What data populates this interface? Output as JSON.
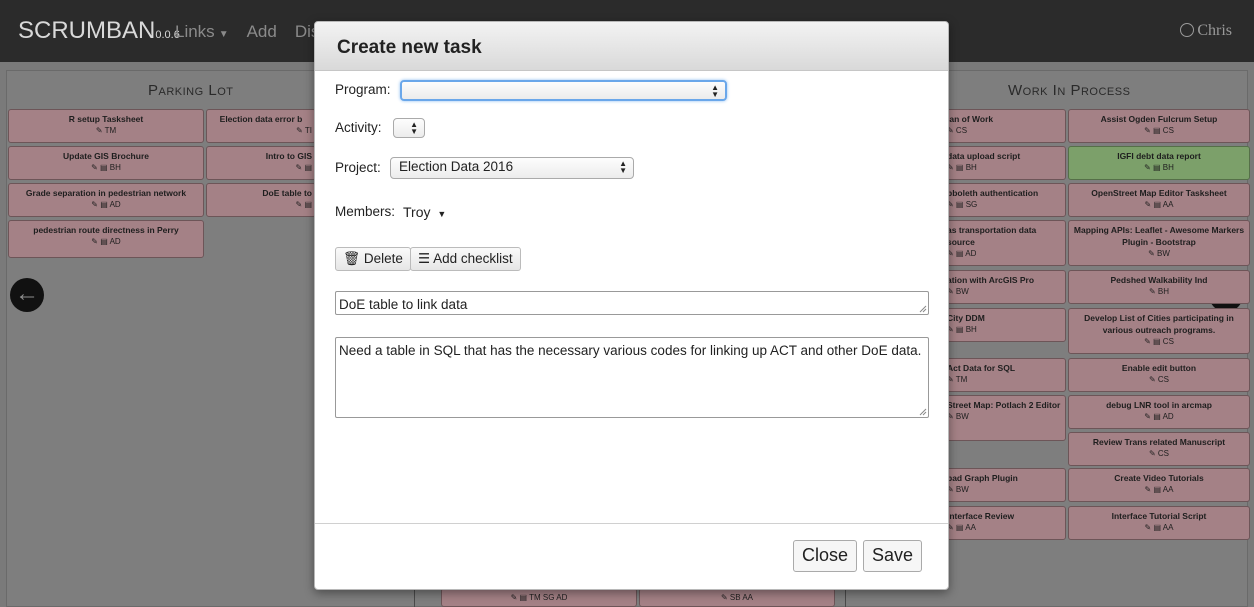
{
  "navbar": {
    "brand": "SCRUMBAN",
    "version": "0.0.6",
    "links": [
      {
        "label": "Links",
        "caret": true
      },
      {
        "label": "Add",
        "caret": false
      },
      {
        "label": "Dis",
        "caret": false
      }
    ],
    "user": "Chris"
  },
  "board": {
    "parking_lot": {
      "title": "Parking Lot",
      "cards": [
        {
          "title": "R setup Tasksheet",
          "meta": "✎ TM"
        },
        {
          "title": "Election data error b",
          "meta": "✎ TI"
        },
        {
          "title": "Update GIS Brochure",
          "meta": "✎ ▤ BH"
        },
        {
          "title": "Intro to GIS",
          "meta": "✎ ▤"
        },
        {
          "title": "Grade separation in pedestrian network",
          "meta": "✎ ▤ AD"
        },
        {
          "title": "DoE table to",
          "meta": "✎ ▤"
        },
        {
          "title": "pedestrian route directness in Perry",
          "meta": "✎ ▤ AD"
        }
      ]
    },
    "middle_bottom": [
      {
        "meta": "✎ ▤ TM SG AD"
      },
      {
        "meta": "✎ SB AA"
      }
    ],
    "work_in_process": {
      "title": "Work In Process",
      "left_cards": [
        {
          "title": "lan of Work",
          "meta": "✎ CS"
        },
        {
          "title": "data upload script",
          "meta": "✎ ▤ BH"
        },
        {
          "title": "bboleth authentication",
          "meta": "✎ ▤ SG"
        },
        {
          "title": "as transportation data source",
          "meta": "✎ ▤ AD"
        },
        {
          "title": "ation with ArcGIS Pro",
          "meta": "✎ BW"
        },
        {
          "title": "City DDM",
          "meta": "✎ ▤ BH"
        },
        {
          "title": "Act Data for SQL",
          "meta": "✎ TM"
        },
        {
          "title": "Street Map: Potlach 2 Editor",
          "meta": "✎ BW"
        },
        {
          "title": "bad Graph Plugin",
          "meta": "✎ BW"
        },
        {
          "title": "Interface Review",
          "meta": "✎ ▤ AA"
        }
      ],
      "right_cards": [
        {
          "title": "Assist Ogden Fulcrum Setup",
          "meta": "✎ ▤ CS"
        },
        {
          "title": "IGFI debt data report",
          "meta": "✎ ▤ BH"
        },
        {
          "title": "OpenStreet Map Editor Tasksheet",
          "meta": "✎ ▤ AA"
        },
        {
          "title": "Mapping APIs: Leaflet - Awesome Markers Plugin - Bootstrap",
          "meta": "✎ BW"
        },
        {
          "title": "Pedshed Walkability Ind",
          "meta": "✎ BH"
        },
        {
          "title": "Develop List of Cities participating in various outreach programs.",
          "meta": "✎ ▤ CS"
        },
        {
          "title": "Enable edit button",
          "meta": "✎ CS"
        },
        {
          "title": "debug LNR tool in arcmap",
          "meta": "✎ ▤ AD"
        },
        {
          "title": "Review Trans related Manuscript",
          "meta": "✎ CS"
        },
        {
          "title": "Create Video Tutorials",
          "meta": "✎ ▤ AA"
        },
        {
          "title": "Interface Tutorial Script",
          "meta": "✎ ▤ AA"
        }
      ]
    }
  },
  "modal": {
    "title": "Create new task",
    "program_label": "Program:",
    "program_value": "",
    "activity_label": "Activity:",
    "activity_value": "",
    "project_label": "Project:",
    "project_value": "Election Data 2016",
    "members_label": "Members:",
    "members_value": "Troy",
    "delete_label": "Delete",
    "checklist_label": "Add checklist",
    "task_name": "DoE table to link data",
    "task_description": "Need a table in SQL that has the necessary various codes for linking up ACT and other DoE data.",
    "close_label": "Close",
    "save_label": "Save"
  },
  "colors": {
    "card_pink": "#a48186",
    "card_green": "#7ca06a",
    "focus_blue": "#6aa7ea"
  }
}
